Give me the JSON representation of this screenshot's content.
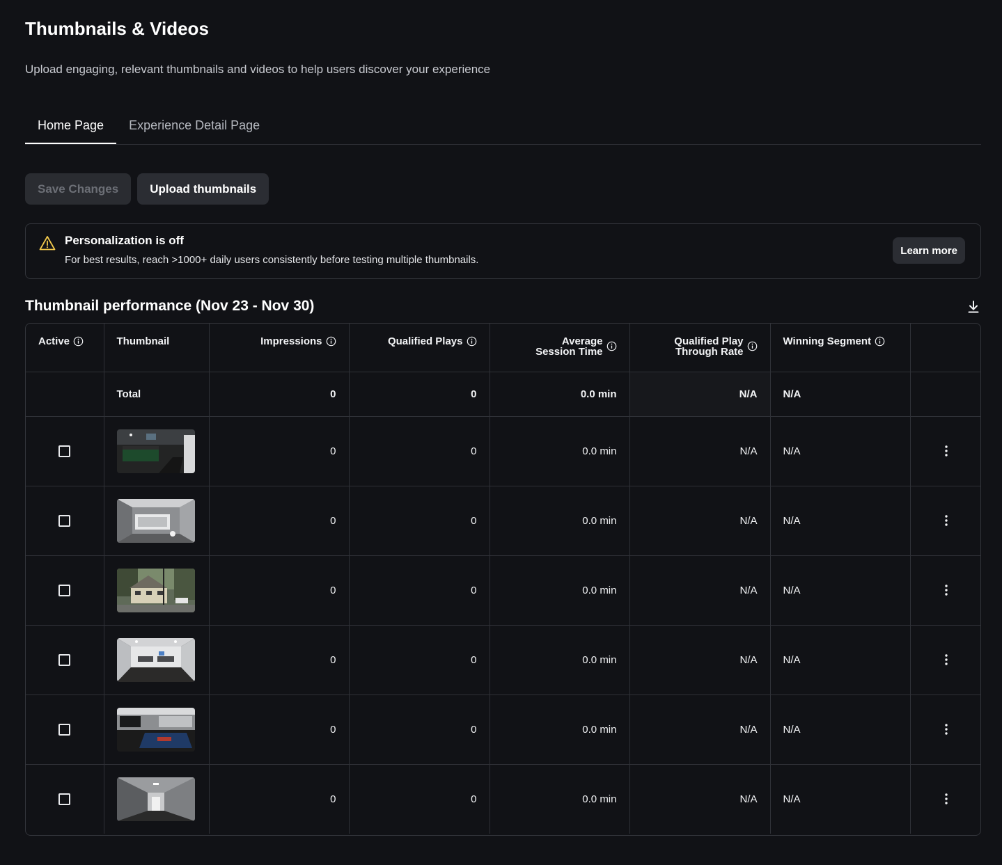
{
  "page": {
    "title": "Thumbnails & Videos",
    "subtitle": "Upload engaging, relevant thumbnails and videos to help users discover your experience"
  },
  "tabs": [
    {
      "label": "Home Page",
      "active": true
    },
    {
      "label": "Experience Detail Page",
      "active": false
    }
  ],
  "actions": {
    "save_label": "Save Changes",
    "upload_label": "Upload thumbnails"
  },
  "banner": {
    "icon": "warning-icon",
    "title": "Personalization is off",
    "text": "For best results, reach >1000+ daily users consistently before testing multiple thumbnails.",
    "button_label": "Learn more"
  },
  "performance": {
    "title": "Thumbnail performance (Nov 23 - Nov 30)",
    "download_icon": "download-icon",
    "columns": {
      "active": "Active",
      "thumbnail": "Thumbnail",
      "impressions": "Impressions",
      "qualified_plays": "Qualified Plays",
      "avg_session_line1": "Average",
      "avg_session_line2": "Session Time",
      "qpr_line1": "Qualified Play",
      "qpr_line2": "Through Rate",
      "winning_segment": "Winning Segment"
    },
    "total": {
      "label": "Total",
      "impressions": "0",
      "qualified_plays": "0",
      "avg_session": "0.0 min",
      "qpr": "N/A",
      "winning_segment": "N/A"
    },
    "rows": [
      {
        "active": false,
        "thumbnail": "dark bedroom with green bed",
        "impressions": "0",
        "qualified_plays": "0",
        "avg_session": "0.0 min",
        "qpr": "N/A",
        "winning_segment": "N/A"
      },
      {
        "active": false,
        "thumbnail": "white room with bathtub",
        "impressions": "0",
        "qualified_plays": "0",
        "avg_session": "0.0 min",
        "qpr": "N/A",
        "winning_segment": "N/A"
      },
      {
        "active": false,
        "thumbnail": "house exterior in forest",
        "impressions": "0",
        "qualified_plays": "0",
        "avg_session": "0.0 min",
        "qpr": "N/A",
        "winning_segment": "N/A"
      },
      {
        "active": false,
        "thumbnail": "office room with desks",
        "impressions": "0",
        "qualified_plays": "0",
        "avg_session": "0.0 min",
        "qpr": "N/A",
        "winning_segment": "N/A"
      },
      {
        "active": false,
        "thumbnail": "room with blue pool table",
        "impressions": "0",
        "qualified_plays": "0",
        "avg_session": "0.0 min",
        "qpr": "N/A",
        "winning_segment": "N/A"
      },
      {
        "active": false,
        "thumbnail": "grey hallway",
        "impressions": "0",
        "qualified_plays": "0",
        "avg_session": "0.0 min",
        "qpr": "N/A",
        "winning_segment": "N/A"
      }
    ]
  },
  "colors": {
    "background": "#111216",
    "border": "#33353b",
    "accent_warning": "#f2c94c"
  }
}
